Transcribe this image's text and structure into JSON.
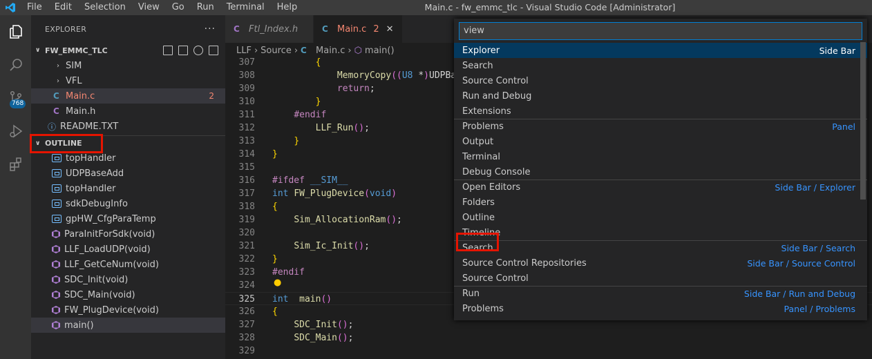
{
  "window": {
    "title": "Main.c - fw_emmc_tlc - Visual Studio Code [Administrator]",
    "menu": [
      "File",
      "Edit",
      "Selection",
      "View",
      "Go",
      "Run",
      "Terminal",
      "Help"
    ]
  },
  "activity": {
    "scm_badge": "768"
  },
  "explorer": {
    "title": "EXPLORER",
    "folder": "FW_EMMC_TLC",
    "files": [
      {
        "name": "SIM",
        "kind": "folder"
      },
      {
        "name": "VFL",
        "kind": "folder"
      },
      {
        "name": "Main.c",
        "kind": "c",
        "badge": "2"
      },
      {
        "name": "Main.h",
        "kind": "h"
      },
      {
        "name": "README.TXT",
        "kind": "info"
      }
    ],
    "outline_title": "OUTLINE",
    "outline": [
      {
        "name": "topHandler",
        "kind": "var"
      },
      {
        "name": "UDPBaseAdd",
        "kind": "var"
      },
      {
        "name": "topHandler",
        "kind": "var"
      },
      {
        "name": "sdkDebugInfo",
        "kind": "var"
      },
      {
        "name": "gpHW_CfgParaTemp",
        "kind": "var"
      },
      {
        "name": "ParaInitForSdk(void)",
        "kind": "fn"
      },
      {
        "name": "LLF_LoadUDP(void)",
        "kind": "fn"
      },
      {
        "name": "LLF_GetCeNum(void)",
        "kind": "fn"
      },
      {
        "name": "SDC_Init(void)",
        "kind": "fn"
      },
      {
        "name": "SDC_Main(void)",
        "kind": "fn"
      },
      {
        "name": "FW_PlugDevice(void)",
        "kind": "fn"
      },
      {
        "name": "main()",
        "kind": "fn"
      }
    ]
  },
  "tabs": [
    {
      "label": "Ftl_Index.h",
      "icon": "C"
    },
    {
      "label": "Main.c",
      "icon": "C",
      "badge": "2",
      "close": "✕"
    }
  ],
  "breadcrumb": [
    "LLF",
    "Source",
    "Main.c",
    "main()"
  ],
  "code": [
    {
      "n": "307",
      "t": "        {"
    },
    {
      "n": "308",
      "t": "            MemoryCopy((U8 *)UDPBa"
    },
    {
      "n": "309",
      "t": "            return;"
    },
    {
      "n": "310",
      "t": "        }"
    },
    {
      "n": "311",
      "t": "    #endif"
    },
    {
      "n": "312",
      "t": "        LLF_Run();"
    },
    {
      "n": "313",
      "t": "    }"
    },
    {
      "n": "314",
      "t": "}"
    },
    {
      "n": "315",
      "t": ""
    },
    {
      "n": "316",
      "t": "#ifdef __SIM__"
    },
    {
      "n": "317",
      "t": "int FW_PlugDevice(void)"
    },
    {
      "n": "318",
      "t": "{"
    },
    {
      "n": "319",
      "t": "    Sim_AllocationRam();"
    },
    {
      "n": "320",
      "t": ""
    },
    {
      "n": "321",
      "t": "    Sim_Ic_Init();"
    },
    {
      "n": "322",
      "t": "}"
    },
    {
      "n": "323",
      "t": "#endif"
    },
    {
      "n": "324",
      "t": ""
    },
    {
      "n": "325",
      "t": "int  main()"
    },
    {
      "n": "326",
      "t": "{"
    },
    {
      "n": "327",
      "t": "    SDC_Init();"
    },
    {
      "n": "328",
      "t": "    SDC_Main();"
    },
    {
      "n": "329",
      "t": ""
    }
  ],
  "palette": {
    "query": "view",
    "items": [
      {
        "label": "Explorer",
        "kb": "Side Bar"
      },
      {
        "label": "Search",
        "kb": ""
      },
      {
        "label": "Source Control",
        "kb": ""
      },
      {
        "label": "Run and Debug",
        "kb": ""
      },
      {
        "label": "Extensions",
        "kb": ""
      },
      {
        "label": "Problems",
        "kb": "Panel"
      },
      {
        "label": "Output",
        "kb": ""
      },
      {
        "label": "Terminal",
        "kb": ""
      },
      {
        "label": "Debug Console",
        "kb": ""
      },
      {
        "label": "Open Editors",
        "kb": "Side Bar / Explorer"
      },
      {
        "label": "Folders",
        "kb": ""
      },
      {
        "label": "Outline",
        "kb": ""
      },
      {
        "label": "Timeline",
        "kb": ""
      },
      {
        "label": "Search",
        "kb": "Side Bar / Search"
      },
      {
        "label": "Source Control Repositories",
        "kb": "Side Bar / Source Control"
      },
      {
        "label": "Source Control",
        "kb": ""
      },
      {
        "label": "Run",
        "kb": "Side Bar / Run and Debug"
      },
      {
        "label": "Problems",
        "kb": "Panel / Problems"
      }
    ]
  }
}
